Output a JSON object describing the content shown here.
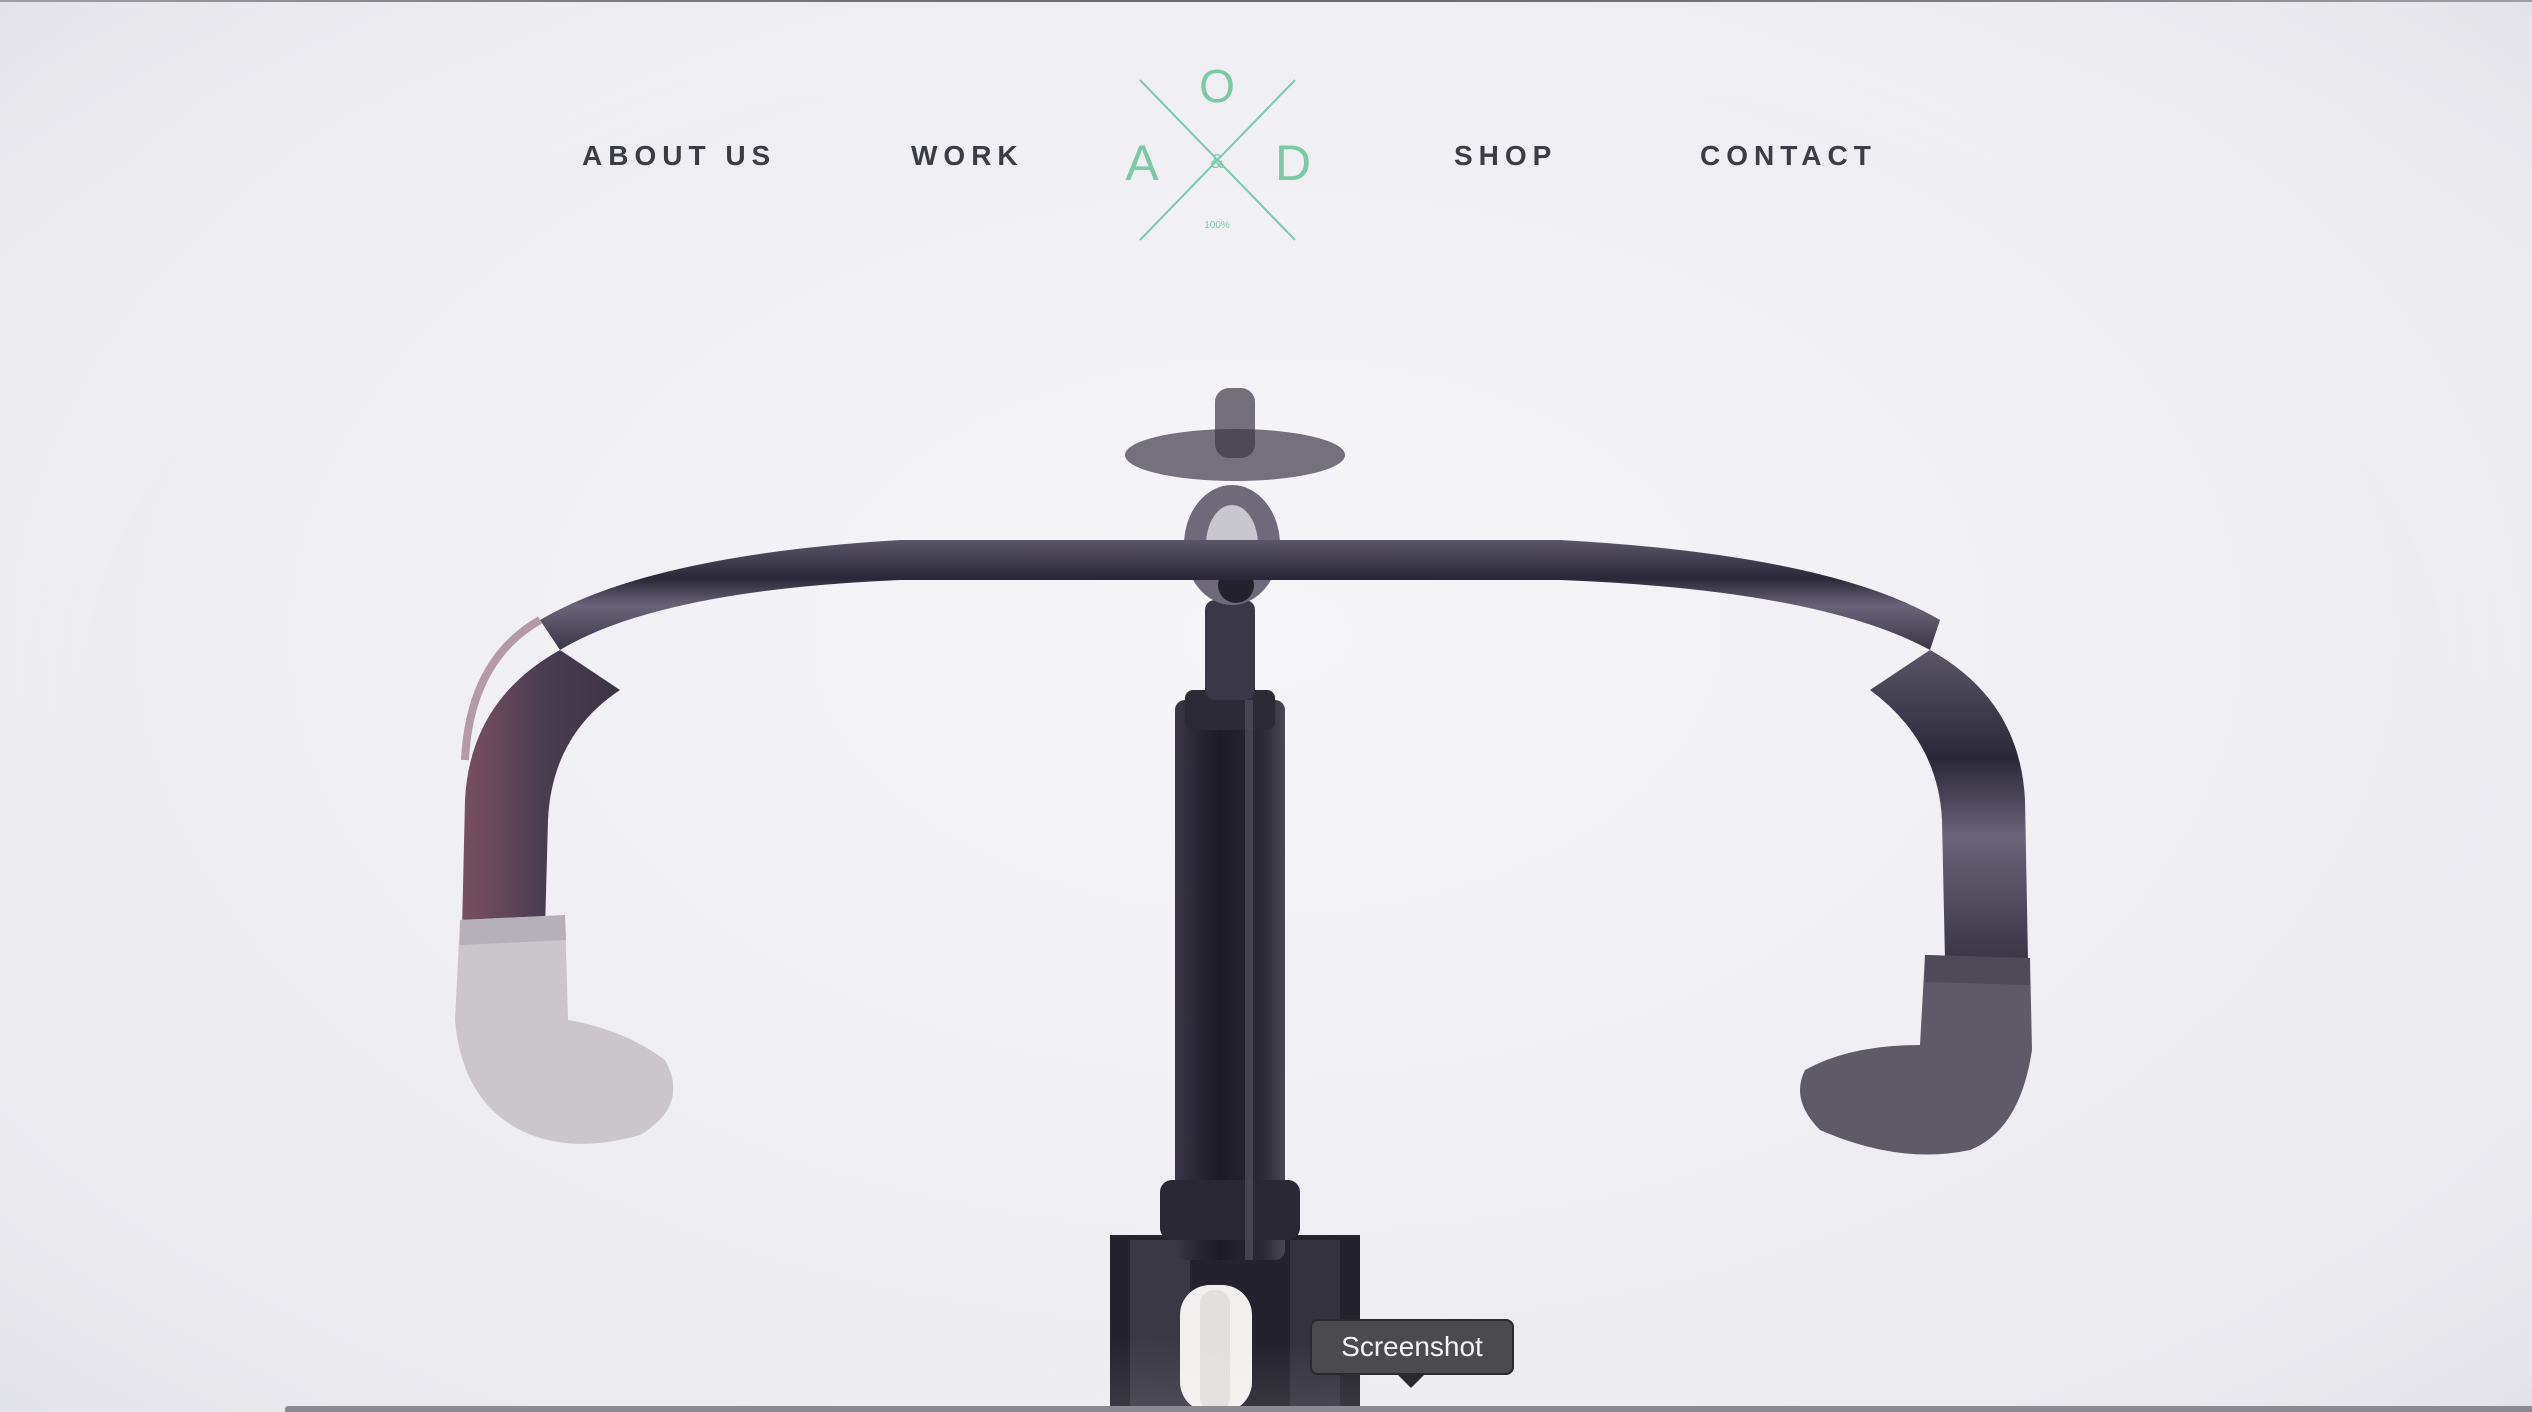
{
  "nav": {
    "items": [
      {
        "label": "ABOUT US"
      },
      {
        "label": "WORK"
      },
      {
        "label": "SHOP"
      },
      {
        "label": "CONTACT"
      }
    ]
  },
  "logo": {
    "letter_top": "O",
    "letter_left": "A",
    "letter_right": "D",
    "ampersand": "&",
    "tagline": "100%",
    "color": "#7cc9a6"
  },
  "hero": {
    "image": "bicycle-handlebar-photo",
    "background_color": "#f0f0f4"
  },
  "tooltip": {
    "label": "Screenshot"
  }
}
